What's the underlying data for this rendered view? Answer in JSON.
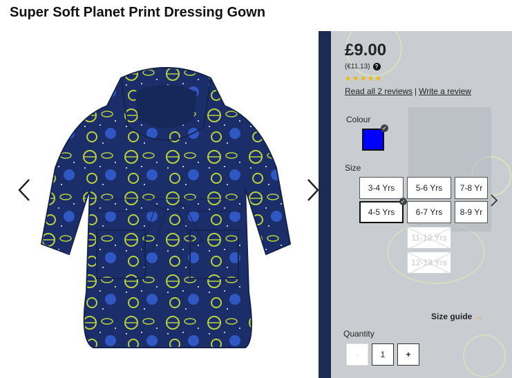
{
  "product": {
    "title": "Super Soft Planet Print Dressing Gown"
  },
  "gallery": {
    "prev_icon": "chevron-left-icon",
    "next_icon": "chevron-right-icon"
  },
  "pricing": {
    "price": "£9.00",
    "euro_price": "(€11.13)",
    "help_icon": "?"
  },
  "rating": {
    "stars": 5,
    "star_color": "#f5b800",
    "read_reviews": "Read all 2 reviews",
    "separator": "|",
    "write_review": "Write a review"
  },
  "colour": {
    "label": "Colour",
    "selected_swatch": "#0000ff"
  },
  "size": {
    "label": "Size",
    "options": [
      {
        "label": "3-4 Yrs",
        "state": "available"
      },
      {
        "label": "5-6 Yrs",
        "state": "available"
      },
      {
        "label": "7-8 Yr",
        "state": "available"
      },
      {
        "label": "4-5 Yrs",
        "state": "selected"
      },
      {
        "label": "6-7 Yrs",
        "state": "available"
      },
      {
        "label": "8-9 Yr",
        "state": "available"
      },
      {
        "label": "11-12 Yrs",
        "state": "disabled"
      },
      {
        "label": "12-13 Yrs",
        "state": "disabled"
      }
    ],
    "guide_label": "Size guide",
    "guide_arrow": "→"
  },
  "quantity": {
    "label": "Quantity",
    "minus": "-",
    "value": "1",
    "plus": "+"
  }
}
